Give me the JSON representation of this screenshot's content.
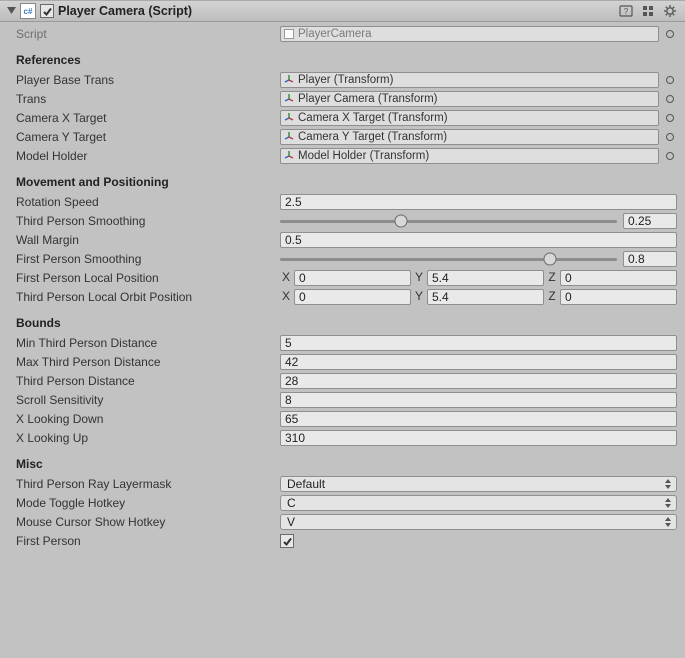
{
  "header": {
    "title": "Player Camera (Script)",
    "enabled": true
  },
  "script": {
    "label": "Script",
    "value": "PlayerCamera"
  },
  "sections": {
    "references": {
      "title": "References",
      "fields": {
        "playerBaseTrans": {
          "label": "Player Base Trans",
          "value": "Player (Transform)"
        },
        "trans": {
          "label": "Trans",
          "value": "Player Camera (Transform)"
        },
        "cameraXTarget": {
          "label": "Camera X Target",
          "value": "Camera X Target (Transform)"
        },
        "cameraYTarget": {
          "label": "Camera Y Target",
          "value": "Camera Y Target (Transform)"
        },
        "modelHolder": {
          "label": "Model Holder",
          "value": "Model Holder (Transform)"
        }
      }
    },
    "movement": {
      "title": "Movement and Positioning",
      "rotationSpeed": {
        "label": "Rotation Speed",
        "value": "2.5"
      },
      "thirdPersonSmoothing": {
        "label": "Third Person Smoothing",
        "value": "0.25",
        "pct": 36
      },
      "wallMargin": {
        "label": "Wall Margin",
        "value": "0.5"
      },
      "firstPersonSmoothing": {
        "label": "First Person Smoothing",
        "value": "0.8",
        "pct": 80
      },
      "firstPersonLocalPos": {
        "label": "First Person Local Position",
        "x": "0",
        "y": "5.4",
        "z": "0"
      },
      "thirdPersonLocalOrbit": {
        "label": "Third Person Local Orbit Position",
        "x": "0",
        "y": "5.4",
        "z": "0"
      }
    },
    "bounds": {
      "title": "Bounds",
      "minThirdDist": {
        "label": "Min Third Person Distance",
        "value": "5"
      },
      "maxThirdDist": {
        "label": "Max Third Person Distance",
        "value": "42"
      },
      "thirdDist": {
        "label": "Third Person Distance",
        "value": "28"
      },
      "scrollSens": {
        "label": "Scroll Sensitivity",
        "value": "8"
      },
      "xLookDown": {
        "label": "X Looking Down",
        "value": "65"
      },
      "xLookUp": {
        "label": "X Looking Up",
        "value": "310"
      }
    },
    "misc": {
      "title": "Misc",
      "layermask": {
        "label": "Third Person Ray Layermask",
        "value": "Default"
      },
      "modeToggle": {
        "label": "Mode Toggle Hotkey",
        "value": "C"
      },
      "cursorShow": {
        "label": "Mouse Cursor Show Hotkey",
        "value": "V"
      },
      "firstPerson": {
        "label": "First Person",
        "checked": true
      }
    }
  },
  "axes": {
    "x": "X",
    "y": "Y",
    "z": "Z"
  }
}
